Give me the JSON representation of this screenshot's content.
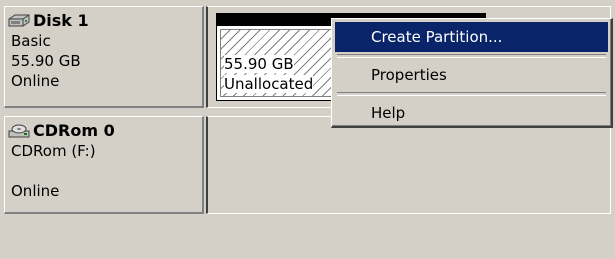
{
  "disk": {
    "name": "Disk 1",
    "type": "Basic",
    "size": "55.90 GB",
    "status": "Online",
    "icon": "hard-disk-icon"
  },
  "volume": {
    "size": "55.90 GB",
    "status": "Unallocated"
  },
  "cdrom": {
    "name": "CDRom 0",
    "drive": "CDRom (F:)",
    "status": "Online",
    "icon": "cd-drive-icon"
  },
  "context_menu": {
    "items": [
      {
        "label": "Create Partition..."
      },
      {
        "label": "Properties"
      },
      {
        "label": "Help"
      }
    ]
  },
  "colors": {
    "face": "#d4d0c8",
    "highlight": "#0a246a",
    "highlight_text": "#ffffff"
  }
}
